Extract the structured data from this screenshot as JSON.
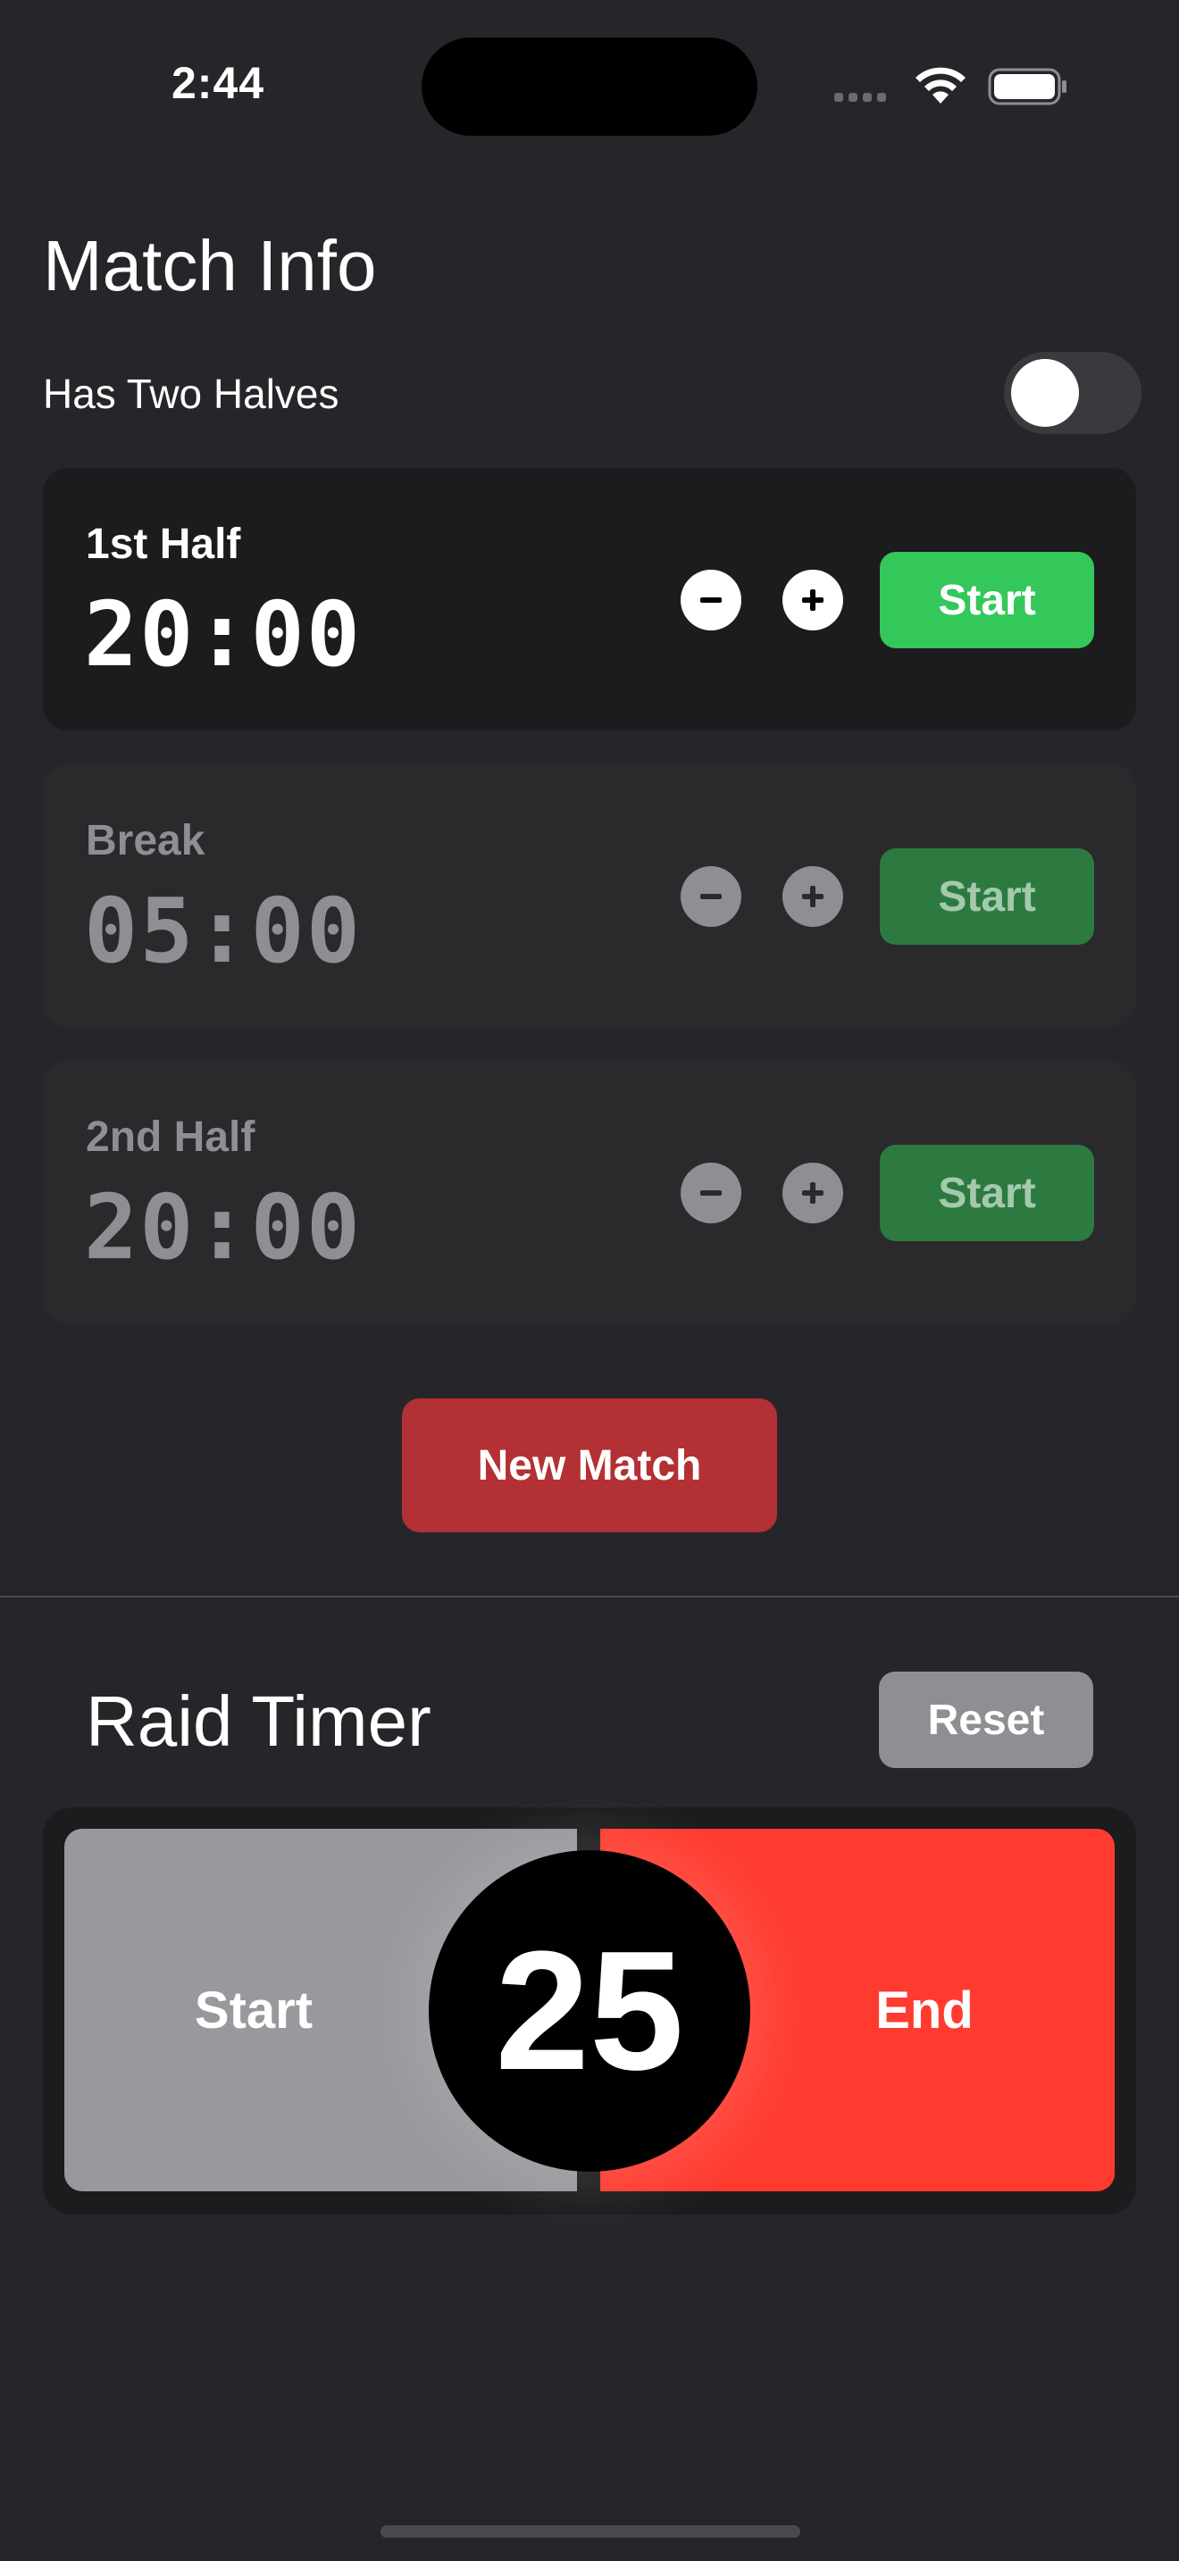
{
  "status_bar": {
    "time": "2:44"
  },
  "match_info": {
    "title": "Match Info",
    "toggle_label": "Has Two Halves",
    "toggle_on": false
  },
  "periods": [
    {
      "label": "1st Half",
      "time": "20:00",
      "start_label": "Start",
      "active": true
    },
    {
      "label": "Break",
      "time": "05:00",
      "start_label": "Start",
      "active": false
    },
    {
      "label": "2nd Half",
      "time": "20:00",
      "start_label": "Start",
      "active": false
    }
  ],
  "new_match_label": "New Match",
  "raid_timer": {
    "title": "Raid Timer",
    "reset_label": "Reset",
    "start_label": "Start",
    "end_label": "End",
    "count": "25"
  },
  "icons": {
    "minus": "minus-circle-icon",
    "plus": "plus-circle-icon",
    "wifi": "wifi-icon",
    "battery": "battery-icon"
  },
  "colors": {
    "background": "#26262a",
    "card": "#1c1c1e",
    "green": "#34c759",
    "red": "#ff3b30",
    "new_match": "#b33034",
    "gray": "#8e8e93"
  }
}
